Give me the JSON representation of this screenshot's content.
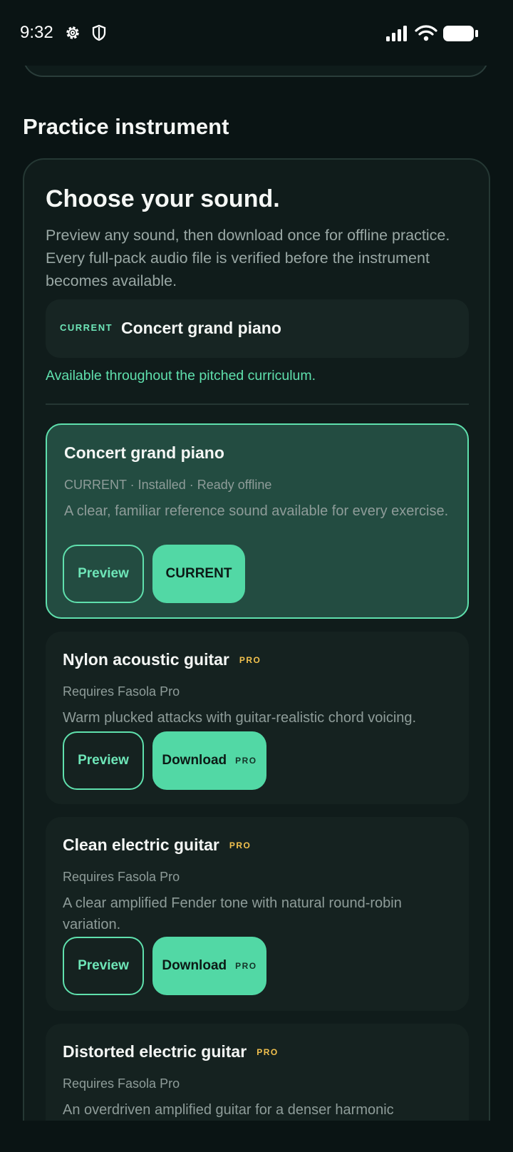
{
  "status_bar": {
    "time": "9:32",
    "icons": [
      "gear-icon",
      "shield-icon",
      "signal-icon",
      "wifi-icon",
      "battery-icon"
    ]
  },
  "section": {
    "title": "Practice instrument"
  },
  "chooser": {
    "title": "Choose your sound.",
    "intro": "Preview any sound, then download once for offline practice. Every full-pack audio file is verified before the instrument becomes available.",
    "current_tag": "CURRENT",
    "current_name": "Concert grand piano",
    "availability": "Available throughout the pitched curriculum."
  },
  "instruments": [
    {
      "name": "Concert grand piano",
      "pro": false,
      "status": "CURRENT · Installed · Ready offline",
      "description": "A clear, familiar reference sound available for every exercise.",
      "preview_label": "Preview",
      "action_label": "CURRENT",
      "selected": true
    },
    {
      "name": "Nylon acoustic guitar",
      "pro": true,
      "pro_label": "PRO",
      "status": "Requires Fasola Pro",
      "description": "Warm plucked attacks with guitar-realistic chord voicing.",
      "preview_label": "Preview",
      "action_label": "Download",
      "action_badge": "PRO",
      "selected": false
    },
    {
      "name": "Clean electric guitar",
      "pro": true,
      "pro_label": "PRO",
      "status": "Requires Fasola Pro",
      "description": "A clear amplified Fender tone with natural round-robin variation.",
      "preview_label": "Preview",
      "action_label": "Download",
      "action_badge": "PRO",
      "selected": false
    },
    {
      "name": "Distorted electric guitar",
      "pro": true,
      "pro_label": "PRO",
      "status": "Requires Fasola Pro",
      "description": "An overdriven amplified guitar for a denser harmonic",
      "selected": false
    }
  ],
  "colors": {
    "background": "#0a1414",
    "accent": "#52d8a5",
    "pro_badge": "#f2c14e",
    "selected_card": "#234c41"
  }
}
